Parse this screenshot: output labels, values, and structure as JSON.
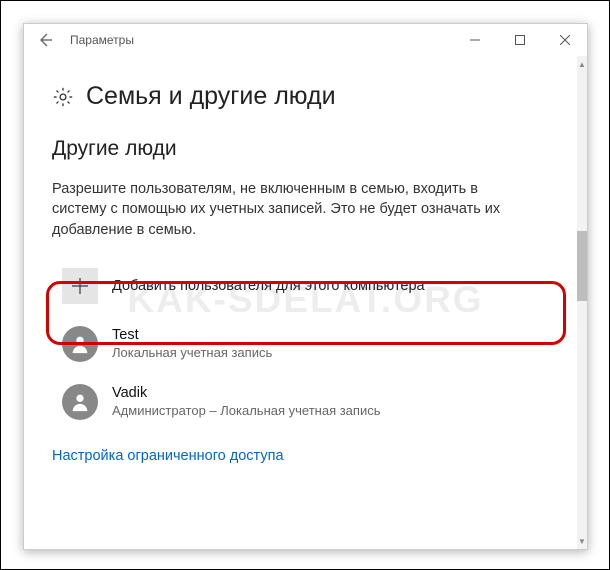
{
  "titlebar": {
    "title": "Параметры"
  },
  "header": {
    "title": "Семья и другие люди"
  },
  "section": {
    "heading": "Другие люди",
    "description": "Разрешите пользователям, не включенным в семью, входить в систему с помощью их учетных записей. Это не будет означать их добавление в семью."
  },
  "add_user": {
    "label": "Добавить пользователя для этого компьютера"
  },
  "users": [
    {
      "name": "Test",
      "subtitle": "Локальная учетная запись"
    },
    {
      "name": "Vadik",
      "subtitle": "Администратор – Локальная учетная запись"
    }
  ],
  "link": {
    "label": "Настройка ограниченного доступа"
  },
  "watermark": "KAK-SDELAT.ORG"
}
